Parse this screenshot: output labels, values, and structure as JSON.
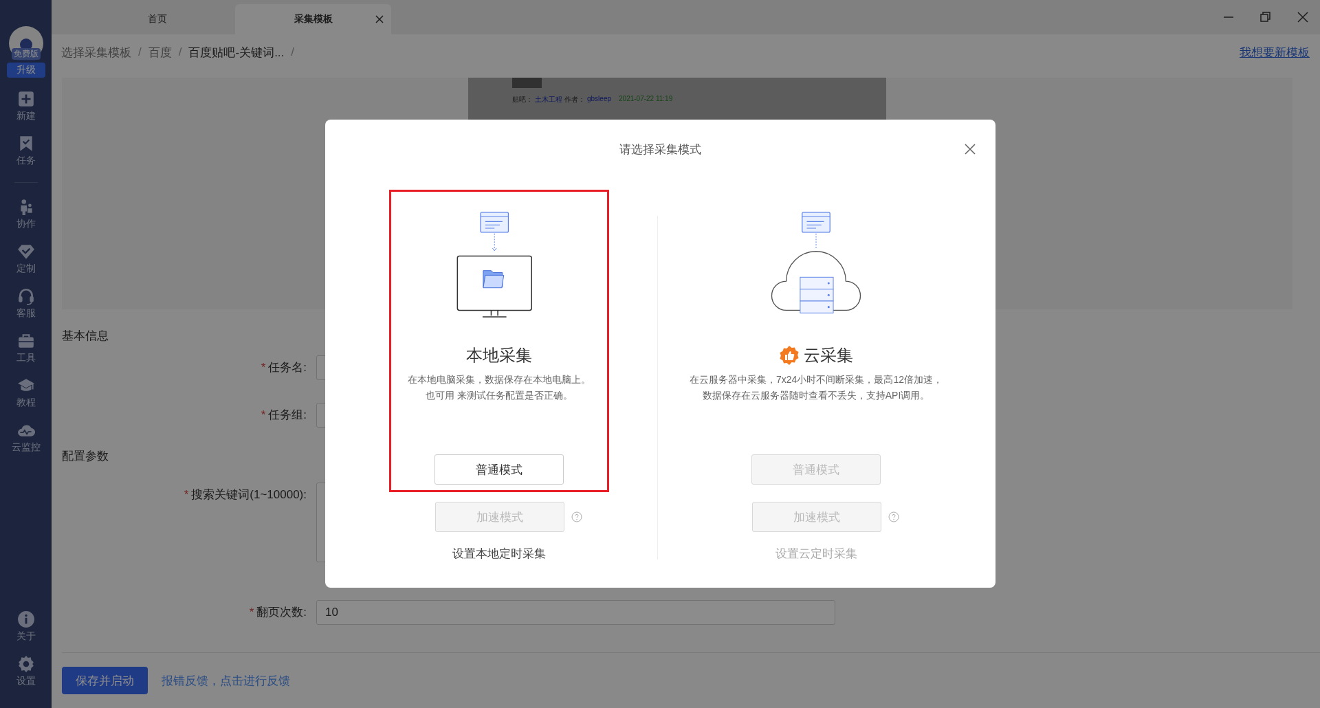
{
  "sidebar": {
    "badge": "免费版",
    "upgrade": "升级",
    "items": [
      {
        "kind": "plus",
        "label": "新建"
      },
      {
        "kind": "bookmark",
        "label": "任务"
      },
      {
        "kind": "divider"
      },
      {
        "kind": "people",
        "label": "协作"
      },
      {
        "kind": "diamond",
        "label": "定制"
      },
      {
        "kind": "headset",
        "label": "客服"
      },
      {
        "kind": "toolbox",
        "label": "工具"
      },
      {
        "kind": "cap",
        "label": "教程"
      },
      {
        "kind": "cloud",
        "label": "云监控"
      }
    ],
    "bottom_items": [
      {
        "kind": "info",
        "label": "关于"
      },
      {
        "kind": "gear",
        "label": "设置"
      }
    ]
  },
  "tabs": [
    {
      "label": "首页",
      "selected": false,
      "closable": false
    },
    {
      "label": "采集模板",
      "selected": true,
      "closable": true
    }
  ],
  "breadcrumb": {
    "separator": "/",
    "items": [
      "选择采集模板",
      "百度",
      "百度贴吧-关键词..."
    ],
    "action": "我想要新模板"
  },
  "preview": {
    "forum_label": "贴吧：",
    "forum": "土木工程",
    "author_label": "作者：",
    "author": "gbsleep",
    "time": "2021-07-22 11:19"
  },
  "sections": [
    {
      "title": "基本信息",
      "fields": [
        {
          "kind": "input",
          "mark": "*",
          "label": "任务名:"
        },
        {
          "kind": "input",
          "mark": "*",
          "label": "任务组:"
        }
      ]
    },
    {
      "title": "配置参数",
      "fields": [
        {
          "kind": "textarea",
          "mark": "*",
          "label": "搜索关键词(1~10000):"
        },
        {
          "kind": "input",
          "mark": "*",
          "label": "翻页次数:",
          "value": "10"
        }
      ]
    }
  ],
  "footer": {
    "primary": "保存并启动",
    "link": "报错反馈，点击进行反馈"
  },
  "modal": {
    "title": "请选择采集模式",
    "options": [
      {
        "kind": "local",
        "selected": true,
        "recommended": false,
        "title": "本地采集",
        "description": [
          "在本地电脑采集，数据保存在本地电脑上。",
          "也可用 来测试任务配置是否正确。"
        ],
        "normal": {
          "label": "普通模式",
          "disabled": false
        },
        "fast": {
          "label": "加速模式",
          "disabled": true
        },
        "schedule": {
          "label": "设置本地定时采集",
          "disabled": false
        }
      },
      {
        "kind": "cloud",
        "selected": false,
        "recommended": true,
        "title": "云采集",
        "description": [
          "在云服务器中采集，7x24小时不间断采集，最高12倍加速，",
          "数据保存在云服务器随时查看不丢失，支持API调用。"
        ],
        "normal": {
          "label": "普通模式",
          "disabled": true
        },
        "fast": {
          "label": "加速模式",
          "disabled": true
        },
        "schedule": {
          "label": "设置云定时采集",
          "disabled": true
        }
      }
    ]
  }
}
